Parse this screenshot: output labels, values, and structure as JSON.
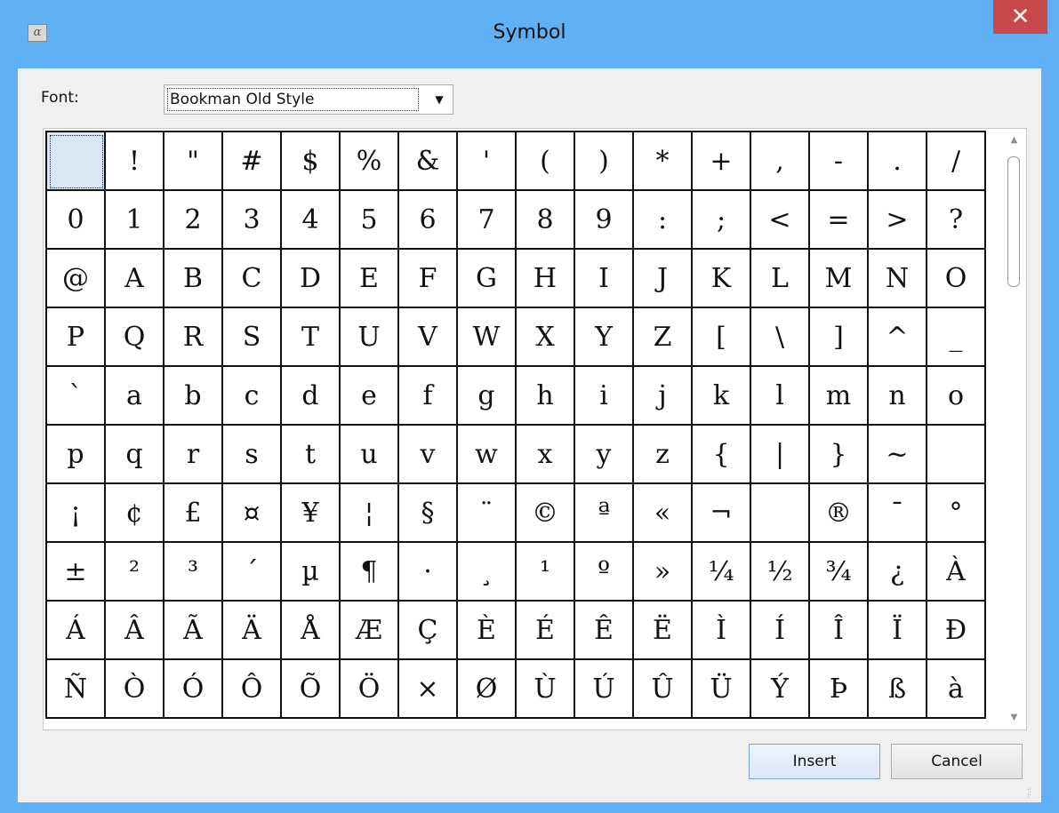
{
  "window": {
    "title": "Symbol",
    "icon": "alpha-icon",
    "icon_glyph": "α",
    "close_glyph": "✕"
  },
  "font": {
    "label": "Font:",
    "value": "Bookman Old Style"
  },
  "symbols": [
    " ",
    "!",
    "\"",
    "#",
    "$",
    "%",
    "&",
    "'",
    "(",
    ")",
    "*",
    "+",
    ",",
    "-",
    ".",
    "/",
    "0",
    "1",
    "2",
    "3",
    "4",
    "5",
    "6",
    "7",
    "8",
    "9",
    ":",
    ";",
    "<",
    "=",
    ">",
    "?",
    "@",
    "A",
    "B",
    "C",
    "D",
    "E",
    "F",
    "G",
    "H",
    "I",
    "J",
    "K",
    "L",
    "M",
    "N",
    "O",
    "P",
    "Q",
    "R",
    "S",
    "T",
    "U",
    "V",
    "W",
    "X",
    "Y",
    "Z",
    "[",
    "\\",
    "]",
    "^",
    "_",
    "`",
    "a",
    "b",
    "c",
    "d",
    "e",
    "f",
    "g",
    "h",
    "i",
    "j",
    "k",
    "l",
    "m",
    "n",
    "o",
    "p",
    "q",
    "r",
    "s",
    "t",
    "u",
    "v",
    "w",
    "x",
    "y",
    "z",
    "{",
    "|",
    "}",
    "~",
    "",
    "¡",
    "¢",
    "£",
    "¤",
    "¥",
    "¦",
    "§",
    "¨",
    "©",
    "ª",
    "«",
    "¬",
    "",
    "®",
    "¯",
    "°",
    "±",
    "²",
    "³",
    "´",
    "µ",
    "¶",
    "·",
    "¸",
    "¹",
    "º",
    "»",
    "¼",
    "½",
    "¾",
    "¿",
    "À",
    "Á",
    "Â",
    "Ã",
    "Ä",
    "Å",
    "Æ",
    "Ç",
    "È",
    "É",
    "Ê",
    "Ë",
    "Ì",
    "Í",
    "Î",
    "Ï",
    "Ð",
    "Ñ",
    "Ò",
    "Ó",
    "Ô",
    "Õ",
    "Ö",
    "×",
    "Ø",
    "Ù",
    "Ú",
    "Û",
    "Ü",
    "Ý",
    "Þ",
    "ß",
    "à"
  ],
  "selected_index": 0,
  "buttons": {
    "insert": "Insert",
    "cancel": "Cancel"
  }
}
